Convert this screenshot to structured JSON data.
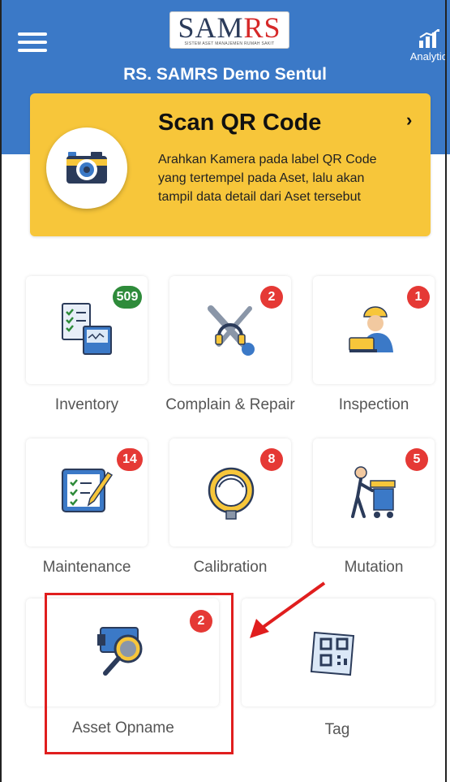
{
  "header": {
    "logo_text_main": "SAM",
    "logo_text_accent": "RS",
    "logo_subtitle": "SISTEM ASET MANAJEMEN RUMAH SAKIT",
    "hospital_name": "RS. SAMRS Demo Sentul",
    "analytic_label": "Analytic",
    "menu_icon": "hamburger-menu-icon",
    "analytic_icon": "bar-chart-icon",
    "color": "#3b79c7"
  },
  "scan_card": {
    "title": "Scan QR Code",
    "description": "Arahkan Kamera pada label QR Code yang tertempel pada Aset, lalu akan tampil data detail dari Aset tersebut",
    "chevron": "›",
    "icon": "camera-icon",
    "color": "#f7c63a"
  },
  "menu_tiles": [
    {
      "label": "Inventory",
      "badge": "509",
      "badge_color": "#2e8b3a",
      "icon": "inventory-checklist-icon"
    },
    {
      "label": "Complain & Repair",
      "badge": "2",
      "badge_color": "#e53935",
      "icon": "tools-headset-icon"
    },
    {
      "label": "Inspection",
      "badge": "1",
      "badge_color": "#e53935",
      "icon": "inspector-laptop-icon"
    },
    {
      "label": "Maintenance",
      "badge": "14",
      "badge_color": "#e53935",
      "icon": "checklist-pencil-icon"
    },
    {
      "label": "Calibration",
      "badge": "8",
      "badge_color": "#e53935",
      "icon": "gauge-ring-icon"
    },
    {
      "label": "Mutation",
      "badge": "5",
      "badge_color": "#e53935",
      "icon": "person-cart-icon"
    },
    {
      "label": "Asset Opname",
      "badge": "2",
      "badge_color": "#e53935",
      "icon": "scanner-magnifier-icon"
    },
    {
      "label": "Tag",
      "badge": "",
      "badge_color": "",
      "icon": "qr-tag-icon"
    }
  ],
  "annotation": {
    "highlight_color": "#e01e1e"
  }
}
